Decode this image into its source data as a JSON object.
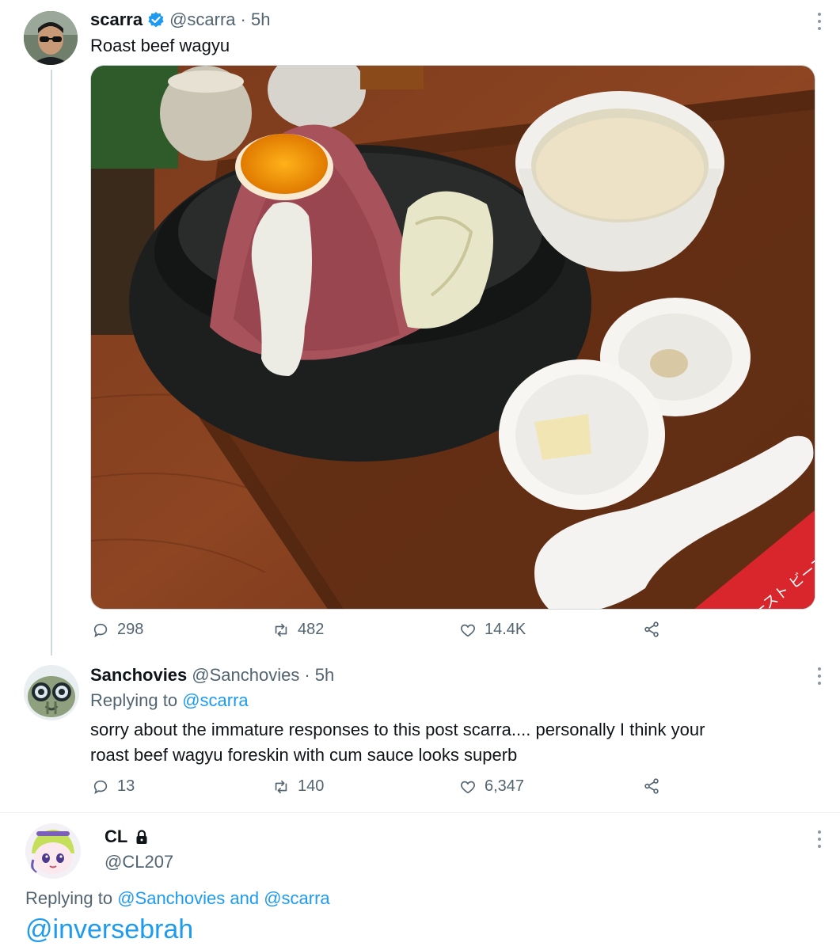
{
  "tweet1": {
    "name": "scarra",
    "handle": "@scarra",
    "time": "· 5h",
    "text": "Roast beef wagyu",
    "stats": {
      "replies": "298",
      "retweets": "482",
      "likes": "14.4K"
    },
    "image_label": "ロースト ビーフ ROAST BEE"
  },
  "tweet2": {
    "name": "Sanchovies",
    "handle": "@Sanchovies",
    "time": "· 5h",
    "replying_prefix": "Replying to",
    "replying_handle": "@scarra",
    "text_line1": "sorry about the immature responses to this post scarra.... personally I think your",
    "text_line2": "roast beef wagyu foreskin with cum sauce looks superb",
    "stats": {
      "replies": "13",
      "retweets": "140",
      "likes": "6,347"
    }
  },
  "tweet3": {
    "name": "CL",
    "handle": "@CL207",
    "replying_prefix": "Replying to",
    "replying_handles": "@Sanchovies and @scarra",
    "text": "@inversebrah"
  },
  "colors": {
    "accent": "#1d9bf0",
    "muted": "#536471",
    "divider": "#cfd9de"
  }
}
